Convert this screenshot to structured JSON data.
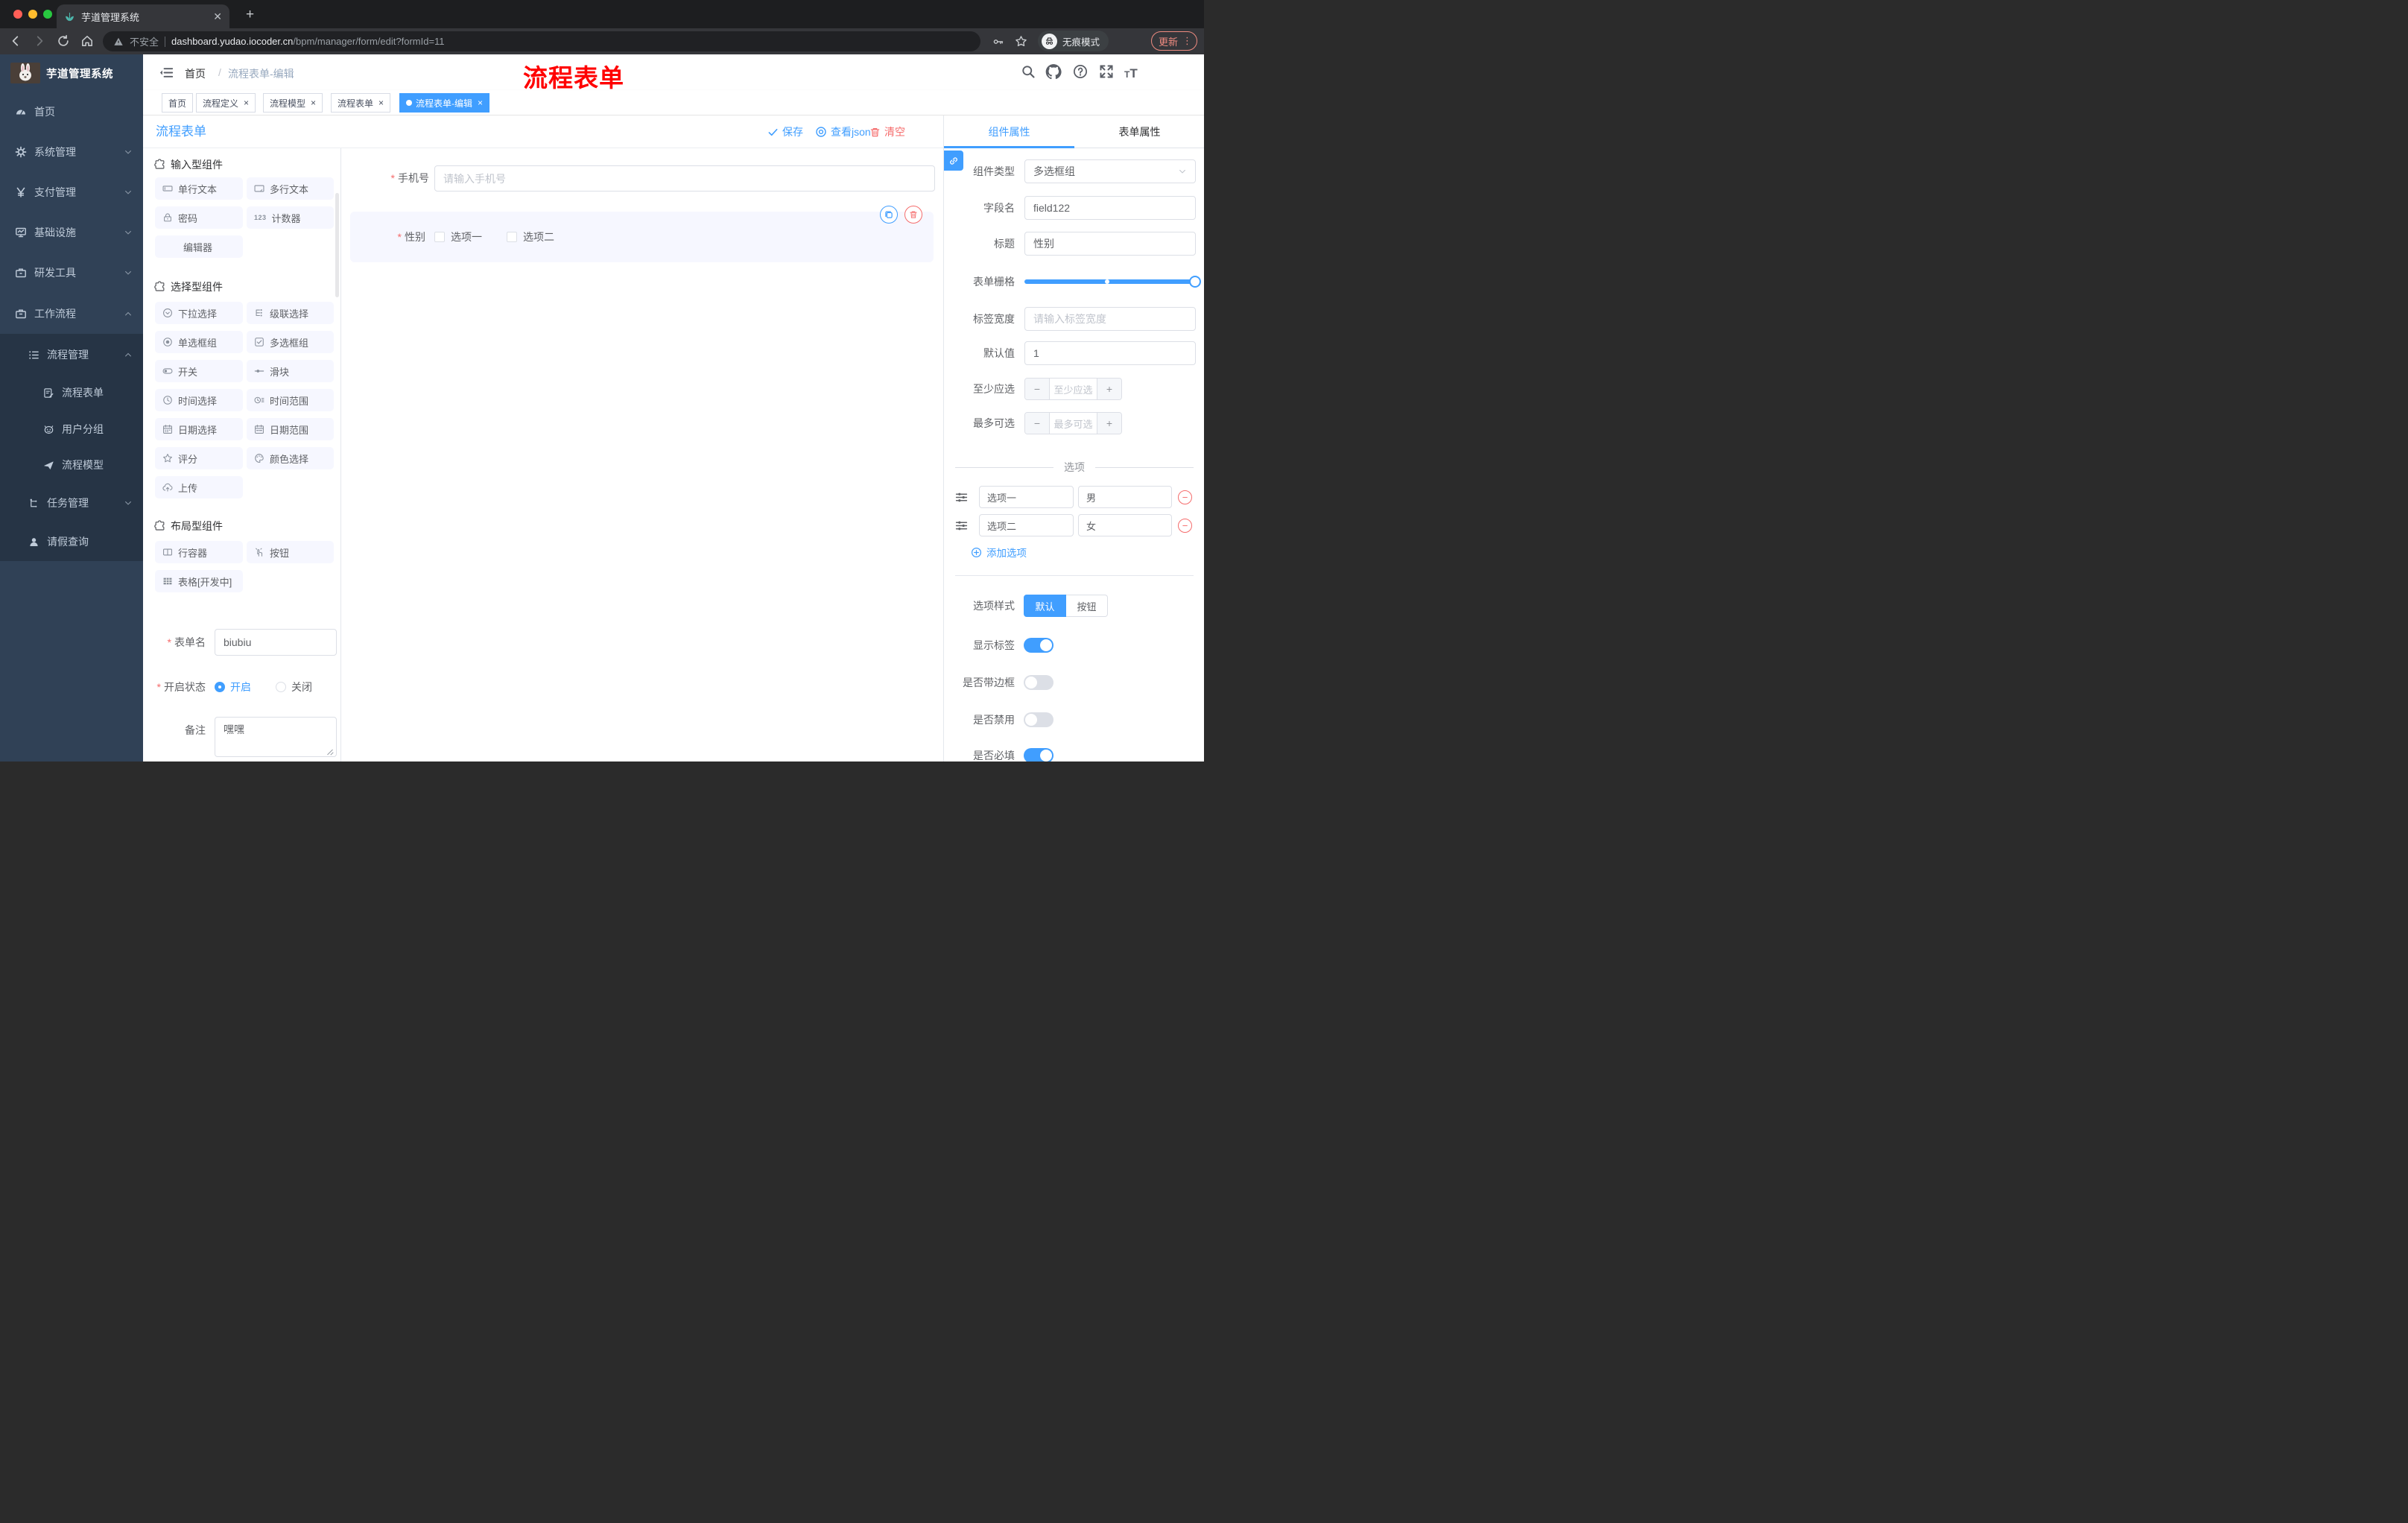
{
  "colors": {
    "accent": "#409eff",
    "danger": "#f56c6c",
    "annotation_red": "#ff0000",
    "sidebar_bg": "#304156",
    "submenu_bg": "#263445",
    "active_tag": "#409eff"
  },
  "browser": {
    "tab_title": "芋道管理系统",
    "security_label": "不安全",
    "url_host": "dashboard.yudao.iocoder.cn",
    "url_path": "/bpm/manager/form/edit?formId=11",
    "incognito_label": "无痕模式",
    "update_label": "更新"
  },
  "sidebar": {
    "app_title": "芋道管理系统",
    "items": [
      {
        "label": "首页",
        "icon": "dashboard-icon"
      },
      {
        "label": "系统管理",
        "icon": "gear-icon"
      },
      {
        "label": "支付管理",
        "icon": "yen-icon"
      },
      {
        "label": "基础设施",
        "icon": "monitor-icon"
      },
      {
        "label": "研发工具",
        "icon": "toolbox-icon"
      },
      {
        "label": "工作流程",
        "icon": "workflow-icon"
      }
    ],
    "submenu": [
      {
        "label": "流程管理",
        "icon": "list-icon"
      },
      {
        "label": "流程表单",
        "icon": "form-doc-icon"
      },
      {
        "label": "用户分组",
        "icon": "robot-icon"
      },
      {
        "label": "流程模型",
        "icon": "send-icon"
      },
      {
        "label": "任务管理",
        "icon": "tree-icon"
      },
      {
        "label": "请假查询",
        "icon": "user-icon"
      }
    ]
  },
  "header": {
    "breadcrumb_home": "首页",
    "breadcrumb_sep": "/",
    "breadcrumb_current": "流程表单-编辑",
    "annotation": "流程表单"
  },
  "tags": [
    {
      "label": "首页"
    },
    {
      "label": "流程定义"
    },
    {
      "label": "流程模型"
    },
    {
      "label": "流程表单"
    },
    {
      "label": "流程表单-编辑"
    }
  ],
  "builder_toolbar": {
    "title": "流程表单",
    "save": "保存",
    "view_json": "查看json",
    "clear": "清空"
  },
  "palette": {
    "sections": [
      {
        "title": "输入型组件",
        "items": [
          {
            "label": "单行文本",
            "icon": "input-icon"
          },
          {
            "label": "多行文本",
            "icon": "textarea-icon"
          },
          {
            "label": "密码",
            "icon": "lock-icon"
          },
          {
            "label": "计数器",
            "icon": "counter-icon"
          },
          {
            "label": "编辑器",
            "icon": "none"
          }
        ]
      },
      {
        "title": "选择型组件",
        "items": [
          {
            "label": "下拉选择",
            "icon": "select-icon"
          },
          {
            "label": "级联选择",
            "icon": "cascader-icon"
          },
          {
            "label": "单选框组",
            "icon": "radio-icon"
          },
          {
            "label": "多选框组",
            "icon": "checkbox-icon"
          },
          {
            "label": "开关",
            "icon": "switch-icon"
          },
          {
            "label": "滑块",
            "icon": "slider-icon"
          },
          {
            "label": "时间选择",
            "icon": "time-icon"
          },
          {
            "label": "时间范围",
            "icon": "time-range-icon"
          },
          {
            "label": "日期选择",
            "icon": "date-icon"
          },
          {
            "label": "日期范围",
            "icon": "date-range-icon"
          },
          {
            "label": "评分",
            "icon": "rate-icon"
          },
          {
            "label": "颜色选择",
            "icon": "color-icon"
          },
          {
            "label": "上传",
            "icon": "upload-icon"
          }
        ]
      },
      {
        "title": "布局型组件",
        "items": [
          {
            "label": "行容器",
            "icon": "row-icon"
          },
          {
            "label": "按钮",
            "icon": "button-icon"
          },
          {
            "label": "表格[开发中]",
            "icon": "table-icon"
          }
        ]
      }
    ]
  },
  "canvas": {
    "phone": {
      "label": "手机号",
      "placeholder": "请输入手机号"
    },
    "gender": {
      "label": "性别",
      "option1": "选项一",
      "option2": "选项二"
    }
  },
  "meta_form": {
    "name_label": "表单名",
    "name_value": "biubiu",
    "status_label": "开启状态",
    "status_on": "开启",
    "status_off": "关闭",
    "remark_label": "备注",
    "remark_value": "嘿嘿"
  },
  "panel": {
    "tab_component": "组件属性",
    "tab_form": "表单属性",
    "type_label": "组件类型",
    "type_value": "多选框组",
    "field_label": "字段名",
    "field_value": "field122",
    "title_label": "标题",
    "title_value": "性别",
    "grid_label": "表单栅格",
    "label_width_label": "标签宽度",
    "label_width_placeholder": "请输入标签宽度",
    "default_label": "默认值",
    "default_value": "1",
    "min_label": "至少应选",
    "min_placeholder": "至少应选",
    "max_label": "最多可选",
    "max_placeholder": "最多可选",
    "options_title": "选项",
    "options": [
      {
        "label": "选项一",
        "value": "男"
      },
      {
        "label": "选项二",
        "value": "女"
      }
    ],
    "add_option": "添加选项",
    "style_label": "选项样式",
    "style_default": "默认",
    "style_button": "按钮",
    "toggles": [
      {
        "label": "显示标签",
        "on": true
      },
      {
        "label": "是否带边框",
        "on": false
      },
      {
        "label": "是否禁用",
        "on": false
      },
      {
        "label": "是否必填",
        "on": true
      }
    ]
  }
}
